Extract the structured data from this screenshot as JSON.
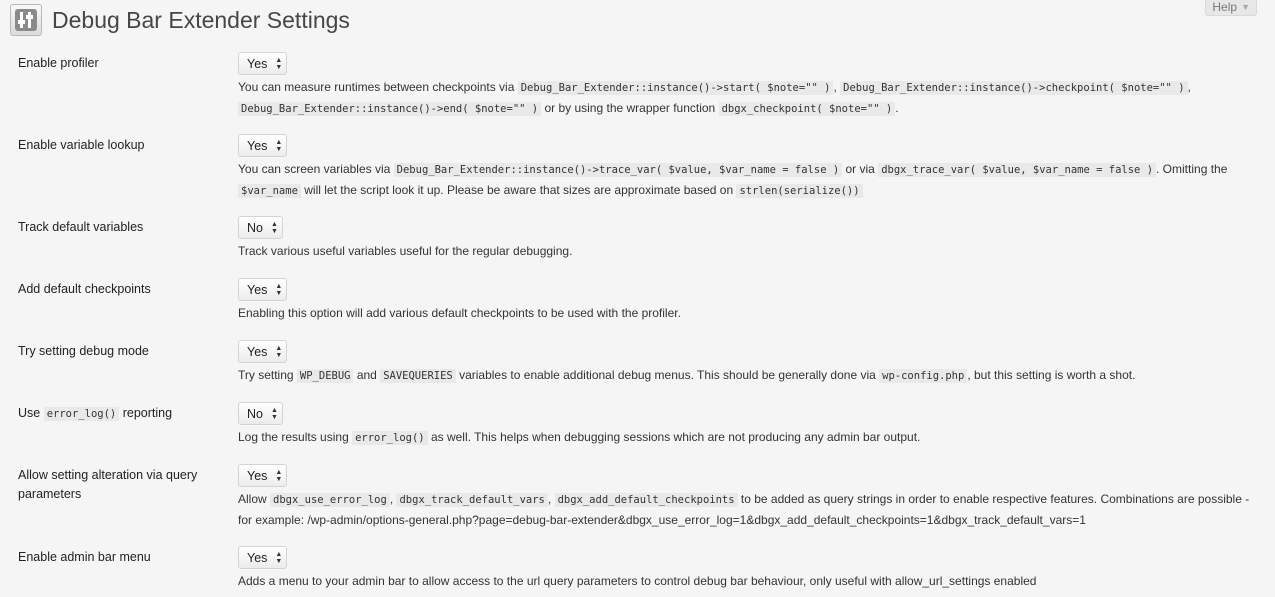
{
  "header": {
    "title": "Debug Bar Extender Settings"
  },
  "help": {
    "label": "Help",
    "arrow": "▼"
  },
  "rows": [
    {
      "label": "Enable profiler",
      "value": "Yes",
      "desc": [
        {
          "t": "You can measure runtimes between checkpoints via "
        },
        {
          "c": "Debug_Bar_Extender::instance()->start( $note=\"\" )"
        },
        {
          "t": ", "
        },
        {
          "c": "Debug_Bar_Extender::instance()->checkpoint( $note=\"\" )"
        },
        {
          "t": ", "
        },
        {
          "c": "Debug_Bar_Extender::instance()->end( $note=\"\" )"
        },
        {
          "t": " or by using the wrapper function "
        },
        {
          "c": "dbgx_checkpoint( $note=\"\" )"
        },
        {
          "t": "."
        }
      ]
    },
    {
      "label": "Enable variable lookup",
      "value": "Yes",
      "desc": [
        {
          "t": "You can screen variables via "
        },
        {
          "c": "Debug_Bar_Extender::instance()->trace_var( $value, $var_name = false )"
        },
        {
          "t": " or via "
        },
        {
          "c": "dbgx_trace_var( $value, $var_name = false )"
        },
        {
          "t": ". Omitting the "
        },
        {
          "c": "$var_name"
        },
        {
          "t": " will let the script look it up. Please be aware that sizes are approximate based on "
        },
        {
          "c": "strlen(serialize())"
        }
      ]
    },
    {
      "label": "Track default variables",
      "value": "No",
      "desc": [
        {
          "t": "Track various useful variables useful for the regular debugging."
        }
      ]
    },
    {
      "label": "Add default checkpoints",
      "value": "Yes",
      "desc": [
        {
          "t": "Enabling this option will add various default checkpoints to be used with the profiler."
        }
      ]
    },
    {
      "label": "Try setting debug mode",
      "value": "Yes",
      "desc": [
        {
          "t": "Try setting "
        },
        {
          "c": "WP_DEBUG"
        },
        {
          "t": " and "
        },
        {
          "c": "SAVEQUERIES"
        },
        {
          "t": " variables to enable additional debug menus. This should be generally done via "
        },
        {
          "c": "wp-config.php"
        },
        {
          "t": ", but this setting is worth a shot."
        }
      ]
    },
    {
      "label_parts": [
        {
          "t": "Use "
        },
        {
          "c": "error_log()"
        },
        {
          "t": " reporting"
        }
      ],
      "value": "No",
      "desc": [
        {
          "t": "Log the results using "
        },
        {
          "c": "error_log()"
        },
        {
          "t": " as well. This helps when debugging sessions which are not producing any admin bar output."
        }
      ]
    },
    {
      "label": "Allow setting alteration via query parameters",
      "value": "Yes",
      "desc": [
        {
          "t": "Allow "
        },
        {
          "c": "dbgx_use_error_log"
        },
        {
          "t": ", "
        },
        {
          "c": "dbgx_track_default_vars"
        },
        {
          "t": ", "
        },
        {
          "c": "dbgx_add_default_checkpoints"
        },
        {
          "t": " to be added as query strings in order to enable respective features. Combinations are possible - for example: /wp-admin/options-general.php?page=debug-bar-extender&dbgx_use_error_log=1&dbgx_add_default_checkpoints=1&dbgx_track_default_vars=1"
        }
      ]
    },
    {
      "label": "Enable admin bar menu",
      "value": "Yes",
      "desc": [
        {
          "t": "Adds a menu to your admin bar to allow access to the url query parameters to control debug bar behaviour, only useful with allow_url_settings enabled"
        }
      ]
    }
  ]
}
